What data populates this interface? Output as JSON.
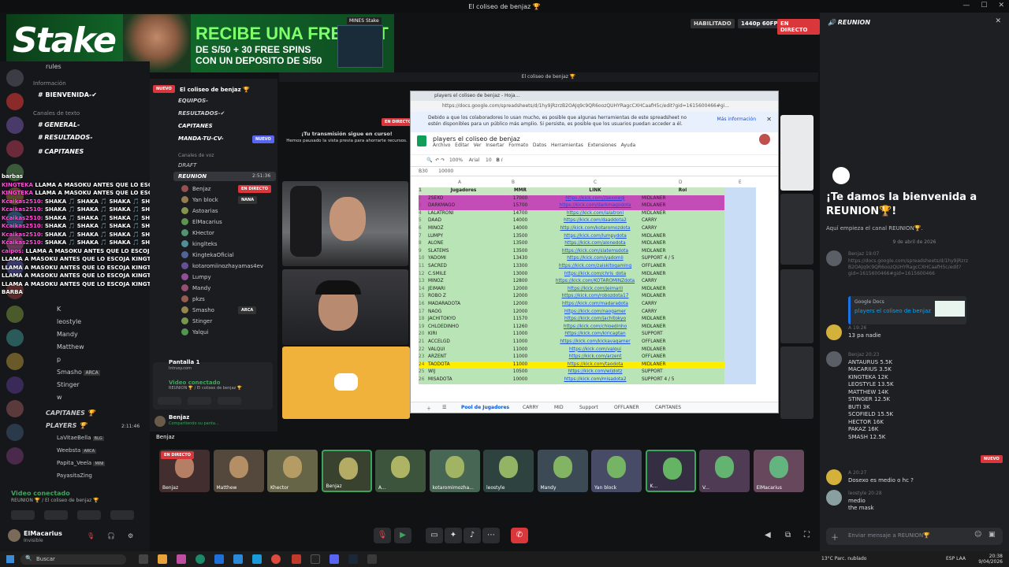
{
  "window": {
    "title": "El coliseo de benjaz 🏆",
    "inner_title": "El coliseo de benjaz 🏆"
  },
  "banner": {
    "logo": "Stake",
    "headline": "RECIBE UNA FREEBET",
    "sub1": "DE S/50 + 30 FREE SPINS",
    "sub2": "CON UN DEPOSITO DE S/50",
    "tag": "MINES Stake"
  },
  "stream": {
    "status": "HABILITADO",
    "quality": "1440p 60FPS",
    "live": "EN DIRECTO",
    "notice_title": "¡Tu transmisión sigue en curso!",
    "notice_body": "Hemos pausado la vista previa para ahorrarte recursos.",
    "live2": "EN DIRECTO"
  },
  "left": {
    "rules": "rules",
    "cat_info": "Información",
    "bienvenida": "BIENVENIDA-✔",
    "cat_text": "Canales de texto",
    "general": "GENERAL-",
    "resultados": "RESULTADOS-",
    "capitanes": "CAPITANES",
    "capitanes2": "CAPITANES 🏆",
    "players": "PLAYERS 🏆",
    "players_time": "2:11:46",
    "p_members": [
      "LaVitaeBella",
      "Weebsta",
      "Papita_Veela",
      "PayasitaZing"
    ],
    "p_tags": [
      "BLG",
      "ARCA",
      "MINI",
      ""
    ],
    "members": [
      "K",
      "leostyle",
      "Mandy",
      "Matthew",
      "p",
      "Smasho",
      "Stinger",
      "w"
    ],
    "member_tags": [
      "",
      "",
      "",
      "",
      "",
      "ARCA",
      "",
      ""
    ],
    "voice": {
      "status": "Video conectado",
      "path": "REUNION 🏆 / El coliseo de benjaz 🏆"
    },
    "user": {
      "name": "ElMacarius",
      "status": "Invisible"
    }
  },
  "chat": [
    {
      "user": "",
      "text": "barbas"
    },
    {
      "user": "KINGTEKA",
      "text": "LLAMA A MASOKU ANTES QUE LO ESCOJA KINGTEKA"
    },
    {
      "user": "KINGTEKA",
      "text": "LLAMA A MASOKU ANTES QUE LO ESCOJA KINGTEKA"
    },
    {
      "user": "Kcaikas2510:",
      "text": "SHAKA 🎵 SHAKA 🎵 SHAKA 🎵 SHAKA 🎵 SHAKA"
    },
    {
      "user": "Kcaikas2510:",
      "text": "SHAKA 🎵 SHAKA 🎵 SHAKA 🎵 SHAKA 🎵 SHAKA"
    },
    {
      "user": "Kcaikas2510:",
      "text": "SHAKA 🎵 SHAKA 🎵 SHAKA 🎵 SHAKA 🎵 SHAKA"
    },
    {
      "user": "Kcaikas2510:",
      "text": "SHAKA 🎵 SHAKA 🎵 SHAKA 🎵 SHAKA 🎵 SHAKA"
    },
    {
      "user": "Kcaikas2510:",
      "text": "SHAKA 🎵 SHAKA 🎵 SHAKA 🎵 SHAKA 🎵 SHAKA"
    },
    {
      "user": "Kcaikas2510:",
      "text": "SHAKA 🎵 SHAKA 🎵 SHAKA 🎵 SHAKA 🎵 SHAKA"
    },
    {
      "user": "caipos:",
      "text": "LLAMA A MASOKU ANTES QUE LO ESCOJA KINGTEKA"
    },
    {
      "user": "",
      "text": "LLAMA A MASOKU ANTES QUE LO ESCOJA KINGTEKA"
    },
    {
      "user": "",
      "text": "LLAMA A MASOKU ANTES QUE LO ESCOJA KINGTEKA"
    },
    {
      "user": "",
      "text": "LLAMA A MASOKU ANTES QUE LO ESCOJA KINGTEKA"
    },
    {
      "user": "",
      "text": "LLAMA A MASOKU ANTES QUE LO ESCOJA KINGTEKA"
    },
    {
      "user": "",
      "text": "BARBA"
    }
  ],
  "mid": {
    "server": "El coliseo de benjaz 🏆",
    "channels": [
      "EQUIPOS-",
      "RESULTADOS-✔",
      "CAPITANES",
      "MANDA-TU-CV-"
    ],
    "new_badge": "NUEVO",
    "cat_voice": "Canales de voz",
    "draft": "DRAFT",
    "reunion": "REUNION",
    "reunion_time": "2:51:36",
    "voice_members": [
      "Benjaz",
      "Yan block",
      "Astoarias",
      "ElMacarius",
      "KHector",
      "kinglteks",
      "KingtekaOficial",
      "kotaromiinozhayamas4ev",
      "Lumpy",
      "Mandy",
      "pkzs",
      "Smasho",
      "Stinger",
      "Yalqui"
    ],
    "voice_tags": [
      "EN DIRECTO",
      "NANA",
      "",
      "",
      "",
      "",
      "",
      "",
      "",
      "",
      "",
      "ARCA",
      "",
      ""
    ],
    "screen": "Pantalla 1",
    "screen_sub": "Intrusy.com",
    "voice_status": "Video conectado",
    "voice_path": "REUNION 🏆 / El coliseo de benjaz 🏆",
    "user": "Benjaz",
    "user_status": "Compartiendo su panta..."
  },
  "sheet": {
    "tab": "players el coliseo de benjaz - Hoja...",
    "url": "https://docs.google.com/spreadsheets/d/1hy9jRzrzB2OAJq9c9QR6oozQUHYRagcCXHCaafH5c/edit?gid=1615600466#gi...",
    "info": "Debido a que los colaboradores lo usan mucho, es posible que algunas herramientas de este spreadsheet no estén disponibles para un público más amplio. Si persiste, es posible que los usuarios puedan acceder a él.",
    "info_link": "Más información",
    "doc_title": "players el coliseo de benjaz",
    "menus": [
      "Archivo",
      "Editar",
      "Ver",
      "Insertar",
      "Formato",
      "Datos",
      "Herramientas",
      "Extensiones",
      "Ayuda"
    ],
    "zoom": "100%",
    "font": "Arial",
    "font_size": "10",
    "cell_ref": "B30",
    "cell_value": "10000",
    "col_letters": [
      "A",
      "B",
      "C",
      "D",
      "E"
    ],
    "headers": [
      "Jugadores",
      "MMR",
      "LINK",
      "Rol"
    ],
    "rows": [
      [
        "2",
        "2SEXO",
        "17000",
        "https://kick.com/zsexoleqi",
        "MIDLANER",
        "#c44cb6"
      ],
      [
        "3",
        "DARKMAGO",
        "15700",
        "https://kick.com/darkmagodota",
        "MIDLANER",
        "#c44cb6"
      ],
      [
        "4",
        "LALATRONI",
        "14700",
        "https://kick.com/lalatroni",
        "MIDLANER",
        "#b9e4b5"
      ],
      [
        "5",
        "DAAD",
        "14000",
        "https://kick.com/daaddota2",
        "CARRY",
        "#b9e4b5"
      ],
      [
        "6",
        "MINOZ",
        "14000",
        "http://kick.com/kotaromozdota",
        "CARRY",
        "#b9e4b5"
      ],
      [
        "7",
        "LUMPY",
        "13500",
        "https://kick.com/lumpydota",
        "MIDLANER",
        "#b9e4b5"
      ],
      [
        "8",
        "ALONE",
        "13500",
        "https://kick.com/alonedota",
        "MIDLANER",
        "#b9e4b5"
      ],
      [
        "9",
        "SLATEMS",
        "13500",
        "https://kick.com/slatemsdota",
        "MIDLANER",
        "#b9e4b5"
      ],
      [
        "10",
        "YADOMI",
        "13430",
        "https://kick.com/yadomii",
        "SUPPORT 4 / 5",
        "#b9e4b5"
      ],
      [
        "11",
        "SACRED",
        "13300",
        "https://kick.com/zaiskitogaming",
        "OFFLANER",
        "#b9e4b5"
      ],
      [
        "12",
        "C.SMILE",
        "13000",
        "https://kick.com/chris_dota",
        "MIDLANER",
        "#b9e4b5"
      ],
      [
        "13",
        "MINOZ",
        "12800",
        "https://kick.com/KOTAROMINZdota",
        "CARRY",
        "#b9e4b5"
      ],
      [
        "14",
        "JEIMARI",
        "12000",
        "https://kick.com/jeimaril",
        "MIDLANER",
        "#b9e4b5"
      ],
      [
        "15",
        "ROBO Z",
        "12000",
        "https://kick.com/robozdota17",
        "MIDLANER",
        "#b9e4b5"
      ],
      [
        "16",
        "MADARADOTA",
        "12000",
        "https://kick.com/madaradota",
        "CARRY",
        "#b9e4b5"
      ],
      [
        "17",
        "NAOG",
        "12000",
        "https://kick.com/naogamer",
        "CARRY",
        "#b9e4b5"
      ],
      [
        "18",
        "JACHITOKYO",
        "11570",
        "https://kick.com/jachitokyo",
        "MIDLANER",
        "#b9e4b5"
      ],
      [
        "19",
        "CHLOEDINHO",
        "11260",
        "https://kick.com/chloedinho",
        "MIDLANER",
        "#b9e4b5"
      ],
      [
        "20",
        "KIRI",
        "11000",
        "https://kick.com/kiricaptan",
        "SUPPORT",
        "#b9e4b5"
      ],
      [
        "21",
        "ACCELGD",
        "11000",
        "https://kick.com/kickavagamer",
        "OFFLANER",
        "#b9e4b5"
      ],
      [
        "22",
        "VALQUI",
        "11000",
        "https://kick.com/valqui",
        "MIDLANER",
        "#b9e4b5"
      ],
      [
        "23",
        "ARZENT",
        "11000",
        "https://kick.com/arzent",
        "OFFLANER",
        "#b9e4b5"
      ],
      [
        "24",
        "TAODOTA",
        "11000",
        "https://kick.com/taodota",
        "MIDLANER",
        "#ffee00"
      ],
      [
        "25",
        "WIJ",
        "10500",
        "https://kick.com/wijdotz",
        "SUPPORT",
        "#b9e4b5"
      ],
      [
        "26",
        "MISADOTA",
        "10000",
        "https://kick.com/misadota2",
        "SUPPORT 4 / 5",
        "#b9e4b5"
      ]
    ],
    "sheet_tabs": [
      "Pool de Jugadores",
      "CARRY",
      "MID",
      "Support",
      "OFFLANER",
      "CAPITANES"
    ]
  },
  "tiles": [
    {
      "name": "Benjaz",
      "live": "EN DIRECTO"
    },
    {
      "name": "Matthew"
    },
    {
      "name": "Khector"
    },
    {
      "name": "Benjaz"
    },
    {
      "name": "A..."
    },
    {
      "name": "kotaromimozha..."
    },
    {
      "name": "leostyle"
    },
    {
      "name": "Mandy"
    },
    {
      "name": "Yan block"
    },
    {
      "name": "K..."
    },
    {
      "name": "V..."
    },
    {
      "name": "ElMacarius"
    }
  ],
  "strip_title": "Benjaz",
  "right": {
    "channel": "REUNION",
    "welcome": "¡Te damos la bienvenida a REUNION🏆!",
    "intro": "Aquí empieza el canal REUNION🏆.",
    "date": "9 de abril de 2026",
    "new_badge": "NUEVO",
    "messages": [
      {
        "who": "Benjaz",
        "time": "19:07",
        "text": "https://docs.google.com/spreadsheets/d/1hy9jRzrz\nB2OAJq9c9QR6oozQUHYRagcCXHCaafH5c/edit?\ngid=1615600466#gid=1615600466"
      },
      {
        "who": "A",
        "time": "19:26",
        "text": "13 pa nadie"
      },
      {
        "who": "Benjaz",
        "time": "20:23",
        "text": "ANTAURUS 5.5K\nMACARIUS 3.5K\nKINGTEKA 12K\nLEOSTYLE 13.5K\nMATTHEW 14K\nSTINGER 12.5K\nBUTI 3K\nSCOFIELD 15.5K\nHECTOR 16K\nPAKAZ 16K\nSMASH 12.5K"
      },
      {
        "who": "A",
        "time": "20:27",
        "text": "Dosexo es medio o hc ?"
      },
      {
        "who": "leostyle",
        "time": "20:28",
        "text": "medio\nthe mask"
      }
    ],
    "embed_src": "Google Docs",
    "embed_title": "players el coliseo de benjaz",
    "input_placeholder": "Enviar mensaje a REUNION🏆"
  },
  "taskbar": {
    "search": "Buscar",
    "weather": "13°C  Parc. nublado",
    "time": "20:38",
    "date": "9/04/2026",
    "lang": "ESP LAA"
  },
  "colors": {
    "accent": "#5865f2",
    "live": "#da373c",
    "stake_green": "#126b2a",
    "sheet_green": "#b9e4b5",
    "highlight": "#ffee00",
    "magenta": "#c44cb6"
  }
}
